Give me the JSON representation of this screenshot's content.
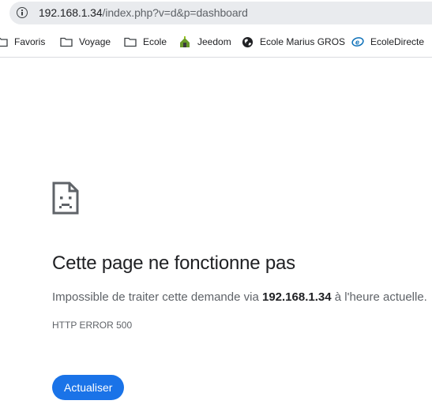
{
  "omnibox": {
    "url_host": "192.168.1.34",
    "url_path": "/index.php?v=d&p=dashboard",
    "info_icon": "info-icon"
  },
  "bookmarks": [
    {
      "label": "Favoris",
      "icon": "folder-icon"
    },
    {
      "label": "Voyage",
      "icon": "folder-icon"
    },
    {
      "label": "Ecole",
      "icon": "folder-icon"
    },
    {
      "label": "Jeedom",
      "icon": "jeedom-icon"
    },
    {
      "label": "Ecole Marius GROS",
      "icon": "globe-icon"
    },
    {
      "label": "EcoleDirecte",
      "icon": "ecoledirecte-icon"
    }
  ],
  "error": {
    "icon": "sad-page-icon",
    "title": "Cette page ne fonctionne pas",
    "desc_prefix": "Impossible de traiter cette demande via ",
    "desc_host": "192.168.1.34",
    "desc_suffix": " à l'heure actuelle.",
    "code": "HTTP ERROR 500",
    "reload_label": "Actualiser"
  },
  "colors": {
    "accent": "#1a73e8",
    "text": "#202124",
    "secondary_text": "#5f6368"
  }
}
